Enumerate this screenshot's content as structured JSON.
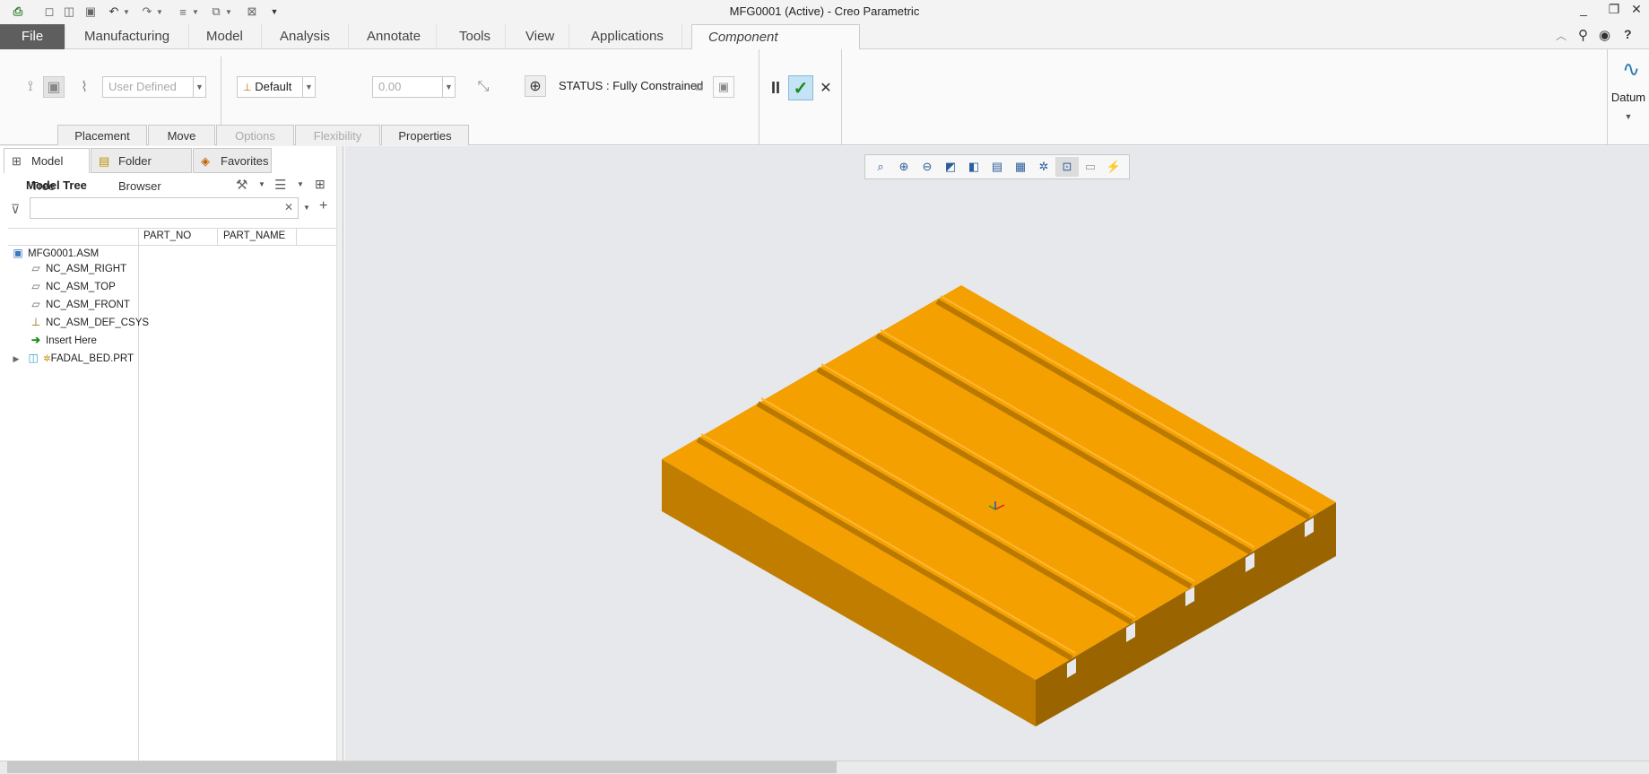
{
  "window": {
    "title": "MFG0001 (Active) - Creo Parametric",
    "controls": [
      "_",
      "❐",
      "✕"
    ]
  },
  "quick_access": [
    "⎙",
    "◻",
    "◫",
    "💾",
    "↶",
    "▾",
    "↷",
    "▾",
    "≡",
    "▾",
    "⧉",
    "▾",
    "⊠",
    "▾"
  ],
  "menu": {
    "tabs": [
      "File",
      "Manufacturing",
      "Model",
      "Analysis",
      "Annotate",
      "Tools",
      "View",
      "Applications",
      "Component Placement"
    ],
    "active": "Component Placement"
  },
  "ribbon": {
    "constraint_type": "User Defined",
    "constraint_default": "Default",
    "offset_value": "0.00",
    "status": "STATUS : Fully Constrained",
    "datum_label": "Datum",
    "subtabs": [
      "Placement",
      "Move",
      "Options",
      "Flexibility",
      "Properties"
    ],
    "disabled_subtabs": [
      "Options",
      "Flexibility"
    ]
  },
  "panel": {
    "tabs": [
      "Model Tree",
      "Folder Browser",
      "Favorites"
    ],
    "heading": "Model Tree",
    "search_placeholder": "",
    "columns": [
      "PART_NO",
      "PART_NAME"
    ],
    "items": [
      {
        "label": "MFG0001.ASM",
        "icon": "assembly-icon"
      },
      {
        "label": "NC_ASM_RIGHT",
        "icon": "datum-plane-icon"
      },
      {
        "label": "NC_ASM_TOP",
        "icon": "datum-plane-icon"
      },
      {
        "label": "NC_ASM_FRONT",
        "icon": "datum-plane-icon"
      },
      {
        "label": "NC_ASM_DEF_CSYS",
        "icon": "csys-icon"
      },
      {
        "label": "Insert Here",
        "icon": "insert-arrow-icon"
      },
      {
        "label": "FADAL_BED.PRT",
        "icon": "part-icon"
      }
    ]
  },
  "colors": {
    "accent_file": "#5e5e5e",
    "part_top": "#f4a000",
    "part_side": "#9a6400",
    "part_front": "#c07d00",
    "viewport_bg": "#e6e8ec"
  }
}
